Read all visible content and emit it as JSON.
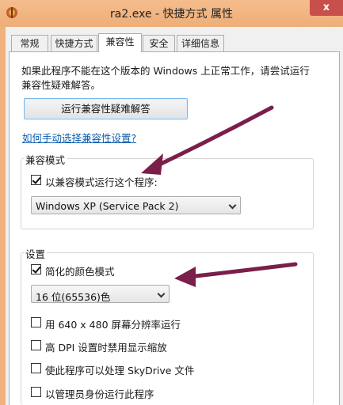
{
  "window": {
    "title": "ra2.exe - 快捷方式 属性",
    "close_label": "x",
    "accent_color": "#f0b37e"
  },
  "tabs": [
    {
      "label": "常规",
      "active": false
    },
    {
      "label": "快捷方式",
      "active": false
    },
    {
      "label": "兼容性",
      "active": true
    },
    {
      "label": "安全",
      "active": false
    },
    {
      "label": "详细信息",
      "active": false
    }
  ],
  "compat": {
    "description": "如果此程序不能在这个版本的 Windows 上正常工作，请尝试运行兼容性疑难解答。",
    "troubleshoot_button": "运行兼容性疑难解答",
    "manual_link": "如何手动选择兼容性设置?",
    "mode_group": {
      "label": "兼容模式",
      "checkbox_label": "以兼容模式运行这个程序:",
      "checked": true,
      "selected_os": "Windows XP (Service Pack 2)"
    },
    "settings_group": {
      "label": "设置",
      "reduced_color": {
        "label": "简化的颜色模式",
        "checked": true
      },
      "color_select": "16 位(65536)色",
      "options": [
        {
          "label": "用 640 x 480 屏幕分辨率运行",
          "checked": false
        },
        {
          "label": "高 DPI 设置时禁用显示缩放",
          "checked": false
        },
        {
          "label": "使此程序可以处理 SkyDrive 文件",
          "checked": false
        },
        {
          "label": "以管理员身份运行此程序",
          "checked": false
        }
      ]
    }
  },
  "annotation": {
    "arrow_color": "#7a1f4a"
  }
}
